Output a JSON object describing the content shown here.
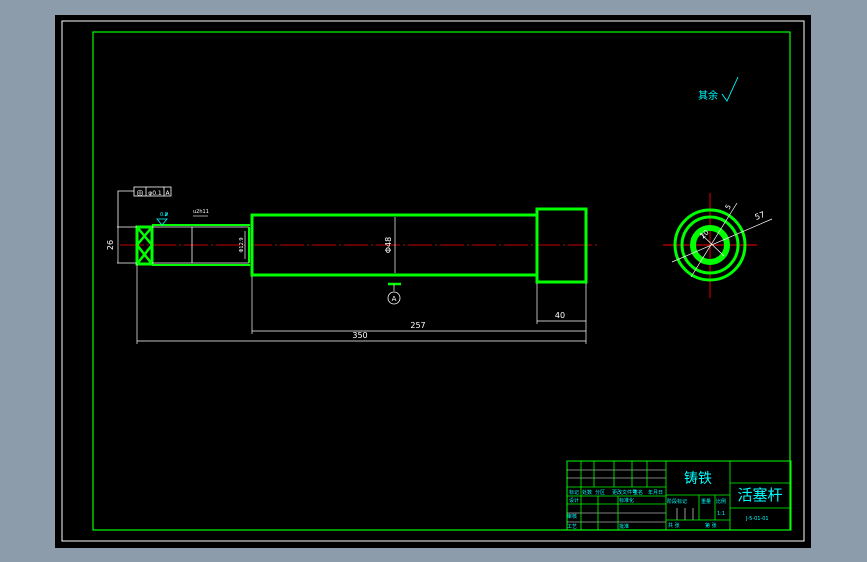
{
  "colors": {
    "background": "#8d9cab",
    "paper": "#000000",
    "outline": "#00ff00",
    "centerline": "#ff0000",
    "dimension": "#ffffff",
    "annotation": "#00ffff"
  },
  "drawing": {
    "tolerance_frame": {
      "symbol": "◎",
      "value": "φ0.1",
      "datum": "A"
    },
    "roughness_top": "0.8",
    "fit_label": "u2h11",
    "dims": {
      "d_left": "26",
      "d_neck": "Φ12.9",
      "d_body": "Φ48",
      "len_head": "40",
      "len_body": "257",
      "len_total": "350",
      "ring_small": "20",
      "ring_mid": "5",
      "ring_large": "57"
    },
    "datum_label": "A",
    "roughness_note": "其余"
  },
  "title_block": {
    "material": "铸铁",
    "part_name": "活塞杆",
    "drawing_no": "J-5-01-01",
    "headers": [
      "标记",
      "处数",
      "分区",
      "更改文件号",
      "签名",
      "年月日"
    ],
    "design": "设计",
    "standardization": "标准化",
    "review": "审核",
    "process": "工艺",
    "approve": "批准",
    "stage_mark": "阶段标记",
    "weight": "重量",
    "scale_label": "比例",
    "scale": "1:1",
    "sheets_total": "共 张",
    "sheet_no": "第 张"
  }
}
